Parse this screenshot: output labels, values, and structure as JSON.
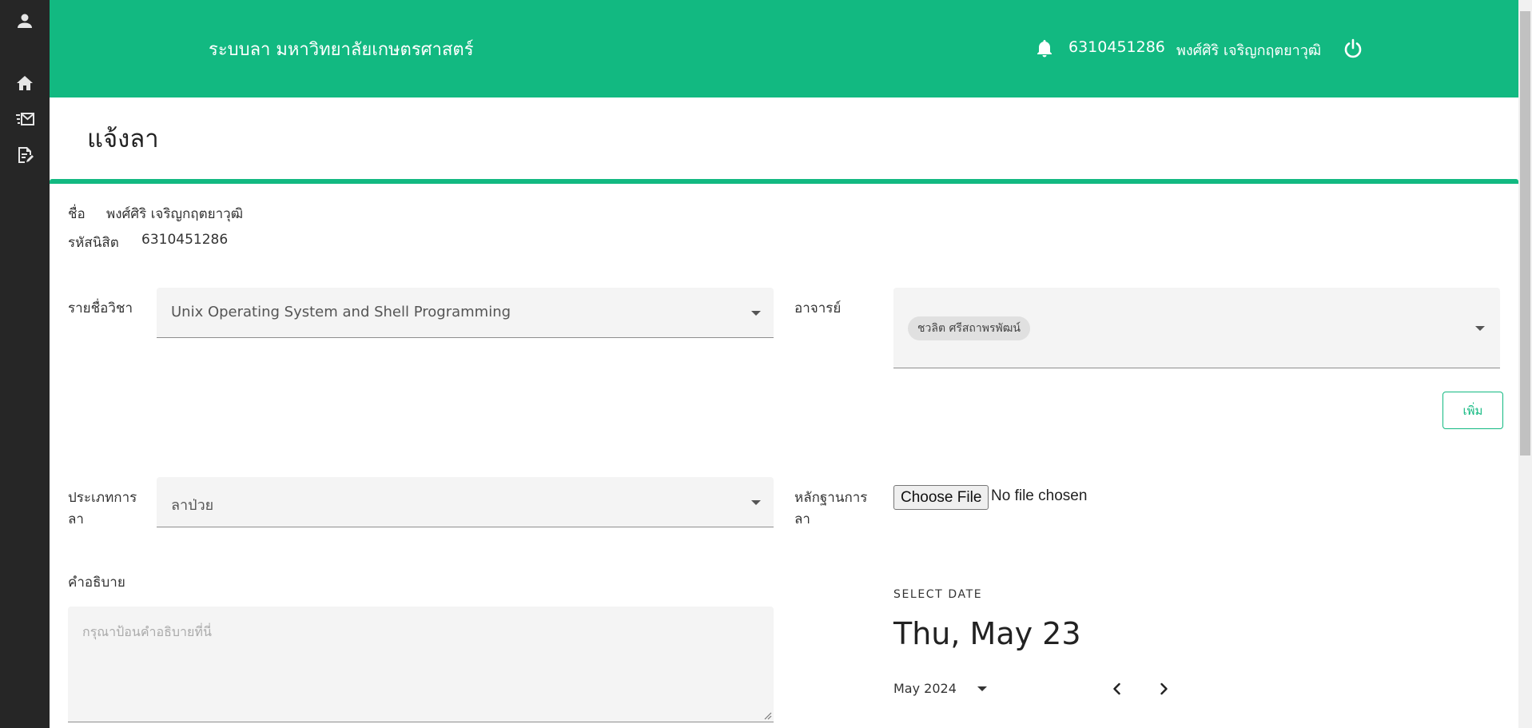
{
  "header": {
    "app_title": "ระบบลา มหาวิทยาลัยเกษตรศาสตร์",
    "student_id": "6310451286",
    "user_name": "พงศ์ศิริ เจริญกฤตยาวุฒิ"
  },
  "sidebar": {
    "icons": [
      "user-icon",
      "home-icon",
      "mail-list-icon",
      "edit-document-icon"
    ]
  },
  "page": {
    "title": "แจ้งลา"
  },
  "info": {
    "name_label": "ชื่อ",
    "name_value": "พงศ์ศิริ เจริญกฤตยาวุฒิ",
    "id_label": "รหัสนิสิต",
    "id_value": "6310451286"
  },
  "form": {
    "subject_label": "รายชื่อวิชา",
    "subject_value": "Unix Operating System and Shell Programming",
    "teacher_label": "อาจารย์",
    "teacher_chip": "ชวลิต ศรีสถาพรพัฒน์",
    "add_button": "เพิ่ม",
    "leave_type_label_1": "ประเภทการ",
    "leave_type_label_2": "ลา",
    "leave_type_value": "ลาป่วย",
    "evidence_label_1": "หลักฐานการ",
    "evidence_label_2": "ลา",
    "file_button": "Choose File",
    "file_status": "No file chosen",
    "description_label": "คำอธิบาย",
    "description_placeholder": "กรุณาป้อนคำอธิบายที่นี่"
  },
  "datepicker": {
    "caption": "SELECT DATE",
    "selected_date": "Thu, May 23",
    "month_year": "May 2024"
  },
  "colors": {
    "accent": "#12b981",
    "sidebar": "#262626",
    "field_bg": "#f4f4f4"
  }
}
